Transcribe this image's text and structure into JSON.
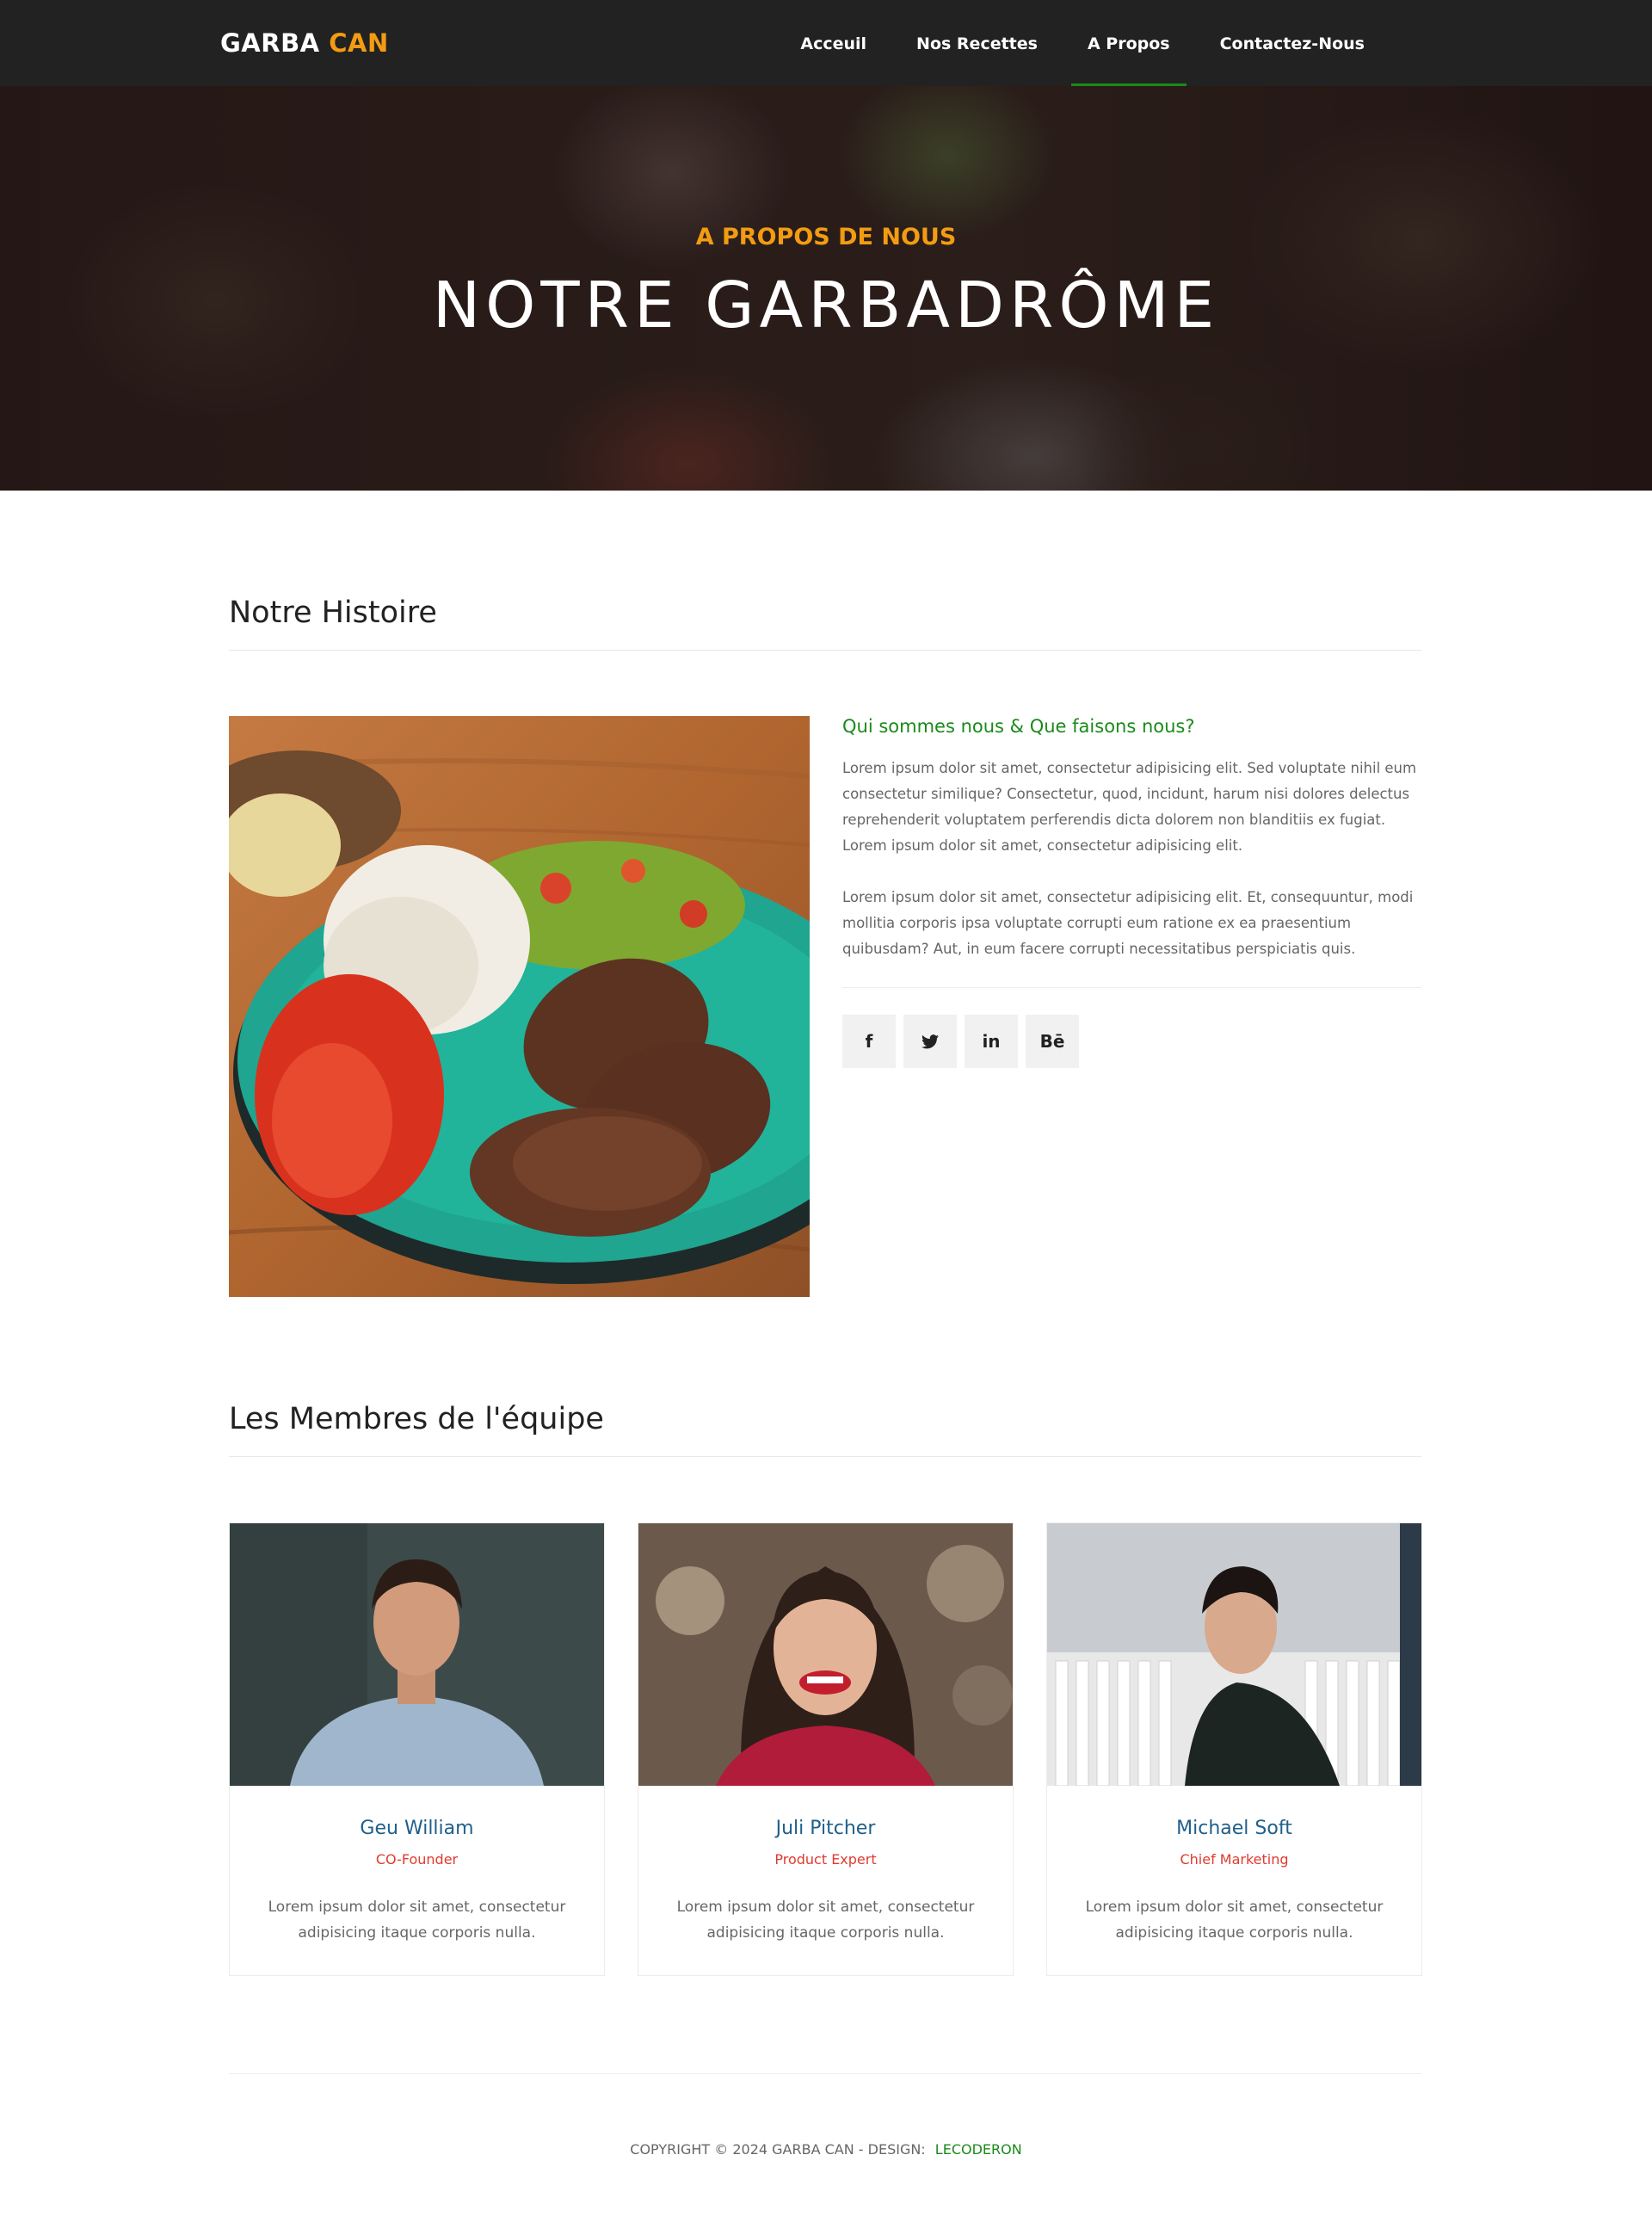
{
  "brand": {
    "part1": "GARBA",
    "part2": "CAN"
  },
  "nav": {
    "items": [
      {
        "label": "Acceuil",
        "active": false
      },
      {
        "label": "Nos Recettes",
        "active": false
      },
      {
        "label": "A Propos",
        "active": true
      },
      {
        "label": "Contactez-Nous",
        "active": false
      }
    ]
  },
  "hero": {
    "subtitle": "A PROPOS DE NOUS",
    "title": "NOTRE GARBADRÔME"
  },
  "about": {
    "section_title": "Notre Histoire",
    "heading": "Qui sommes nous & Que faisons nous?",
    "paragraph1": "Lorem ipsum dolor sit amet, consectetur adipisicing elit. Sed voluptate nihil eum consectetur similique? Consectetur, quod, incidunt, harum nisi dolores delectus reprehenderit voluptatem perferendis dicta dolorem non blanditiis ex fugiat. Lorem ipsum dolor sit amet, consectetur adipisicing elit.",
    "paragraph2": "Lorem ipsum dolor sit amet, consectetur adipisicing elit. Et, consequuntur, modi mollitia corporis ipsa voluptate corrupti eum ratione ex ea praesentium quibusdam? Aut, in eum facere corrupti necessitatibus perspiciatis quis.",
    "socials": [
      {
        "icon": "facebook-icon",
        "glyph": "f"
      },
      {
        "icon": "twitter-icon",
        "glyph": "🐦"
      },
      {
        "icon": "linkedin-icon",
        "glyph": "in"
      },
      {
        "icon": "behance-icon",
        "glyph": "Bē"
      }
    ]
  },
  "team": {
    "section_title": "Les Membres de l'équipe",
    "members": [
      {
        "name": "Geu William",
        "role": "CO-Founder",
        "desc": "Lorem ipsum dolor sit amet, consectetur adipisicing itaque corporis nulla."
      },
      {
        "name": "Juli Pitcher",
        "role": "Product Expert",
        "desc": "Lorem ipsum dolor sit amet, consectetur adipisicing itaque corporis nulla."
      },
      {
        "name": "Michael Soft",
        "role": "Chief Marketing",
        "desc": "Lorem ipsum dolor sit amet, consectetur adipisicing itaque corporis nulla."
      }
    ]
  },
  "footer": {
    "copyright": "COPYRIGHT © 2024 GARBA CAN - DESIGN:",
    "designer": "LECODERON"
  },
  "colors": {
    "navbar": "#222222",
    "brand_accent": "#f39c12",
    "green_accent": "#1a8a1a",
    "name_blue": "#1f5f8b",
    "role_red": "#e03a2f"
  }
}
